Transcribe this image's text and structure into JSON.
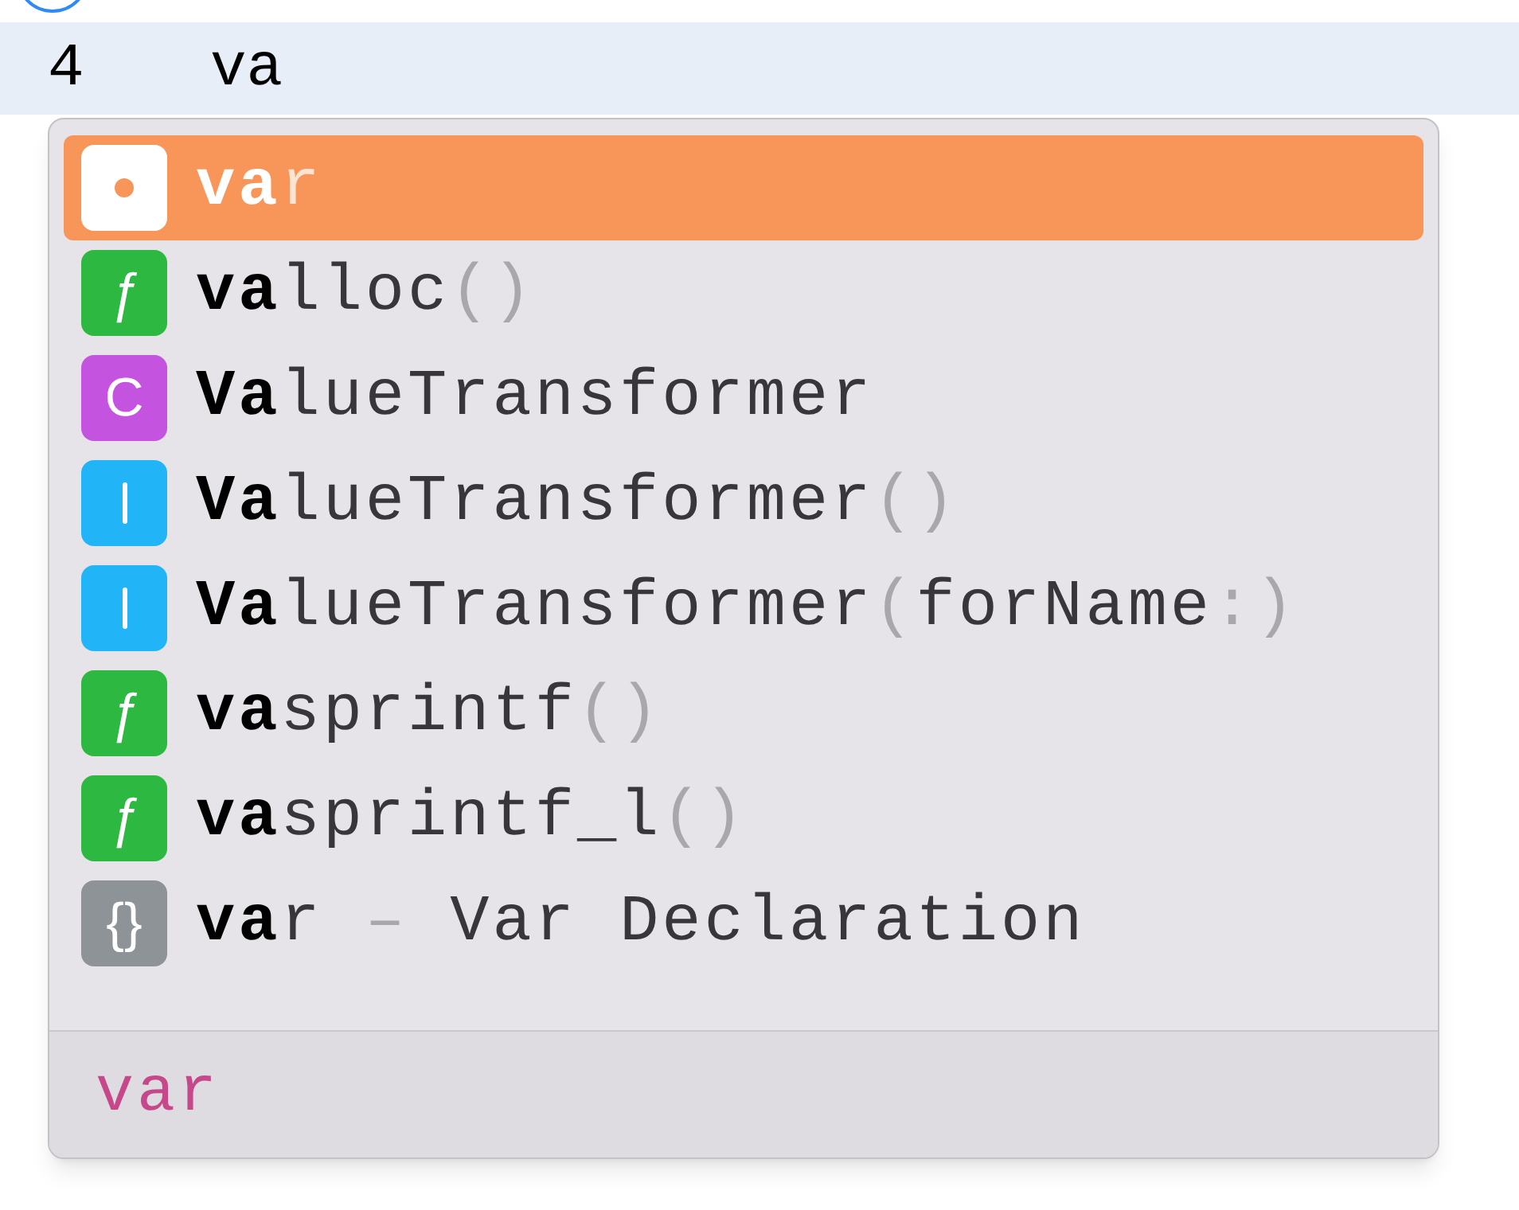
{
  "editor": {
    "line_number": "4",
    "code": "va"
  },
  "completions": [
    {
      "kind": "variable",
      "selected": true,
      "parts": [
        {
          "kind": "match",
          "text": "va"
        },
        {
          "kind": "name",
          "text": "r"
        }
      ]
    },
    {
      "kind": "function",
      "glyph": "ƒ",
      "selected": false,
      "parts": [
        {
          "kind": "match",
          "text": "va"
        },
        {
          "kind": "name",
          "text": "lloc"
        },
        {
          "kind": "punct",
          "text": "()"
        }
      ]
    },
    {
      "kind": "class",
      "glyph": "C",
      "selected": false,
      "parts": [
        {
          "kind": "match",
          "text": "Va"
        },
        {
          "kind": "name",
          "text": "lueTransformer"
        }
      ]
    },
    {
      "kind": "initializer",
      "selected": false,
      "parts": [
        {
          "kind": "match",
          "text": "Va"
        },
        {
          "kind": "name",
          "text": "lueTransformer"
        },
        {
          "kind": "punct",
          "text": "()"
        }
      ]
    },
    {
      "kind": "initializer",
      "selected": false,
      "parts": [
        {
          "kind": "match",
          "text": "Va"
        },
        {
          "kind": "name",
          "text": "lueTransformer"
        },
        {
          "kind": "punct",
          "text": "("
        },
        {
          "kind": "name",
          "text": "forName"
        },
        {
          "kind": "punct",
          "text": ":)"
        }
      ]
    },
    {
      "kind": "function",
      "glyph": "ƒ",
      "selected": false,
      "parts": [
        {
          "kind": "match",
          "text": "va"
        },
        {
          "kind": "name",
          "text": "sprintf"
        },
        {
          "kind": "punct",
          "text": "()"
        }
      ]
    },
    {
      "kind": "function",
      "glyph": "ƒ",
      "selected": false,
      "parts": [
        {
          "kind": "match",
          "text": "va"
        },
        {
          "kind": "name",
          "text": "sprintf_l"
        },
        {
          "kind": "punct",
          "text": "()"
        }
      ]
    },
    {
      "kind": "snippet",
      "glyph": "{}",
      "selected": false,
      "parts": [
        {
          "kind": "match",
          "text": "va"
        },
        {
          "kind": "name",
          "text": "r "
        },
        {
          "kind": "punct",
          "text": "–"
        },
        {
          "kind": "name",
          "text": " Var Declaration"
        }
      ]
    }
  ],
  "footer": {
    "signature": "var"
  }
}
